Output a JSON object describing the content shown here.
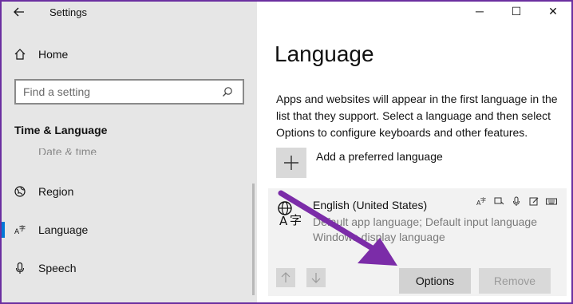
{
  "window": {
    "title": "Settings",
    "minimize_glyph": "─",
    "maximize_glyph": "☐",
    "close_glyph": "✕"
  },
  "sidebar": {
    "home_label": "Home",
    "search_placeholder": "Find a setting",
    "section_heading": "Time & Language",
    "cut_item_label": "Date & time",
    "items": [
      {
        "label": "Region",
        "icon": "region-icon"
      },
      {
        "label": "Language",
        "icon": "language-icon",
        "active": true
      },
      {
        "label": "Speech",
        "icon": "microphone-icon"
      }
    ]
  },
  "main": {
    "title": "Language",
    "description": "Apps and websites will appear in the first language in the list that they support. Select a language and then select Options to configure keyboards and other features.",
    "add_language_label": "Add a preferred language",
    "language_card": {
      "name": "English (United States)",
      "line1": "Default app language; Default input language",
      "line2": "Windows display language",
      "options_label": "Options",
      "remove_label": "Remove"
    }
  },
  "colors": {
    "accent": "#0078d7",
    "frame": "#6b2fa0",
    "annotation_arrow": "#7b2ca8",
    "sidebar_bg": "#e6e6e6"
  }
}
